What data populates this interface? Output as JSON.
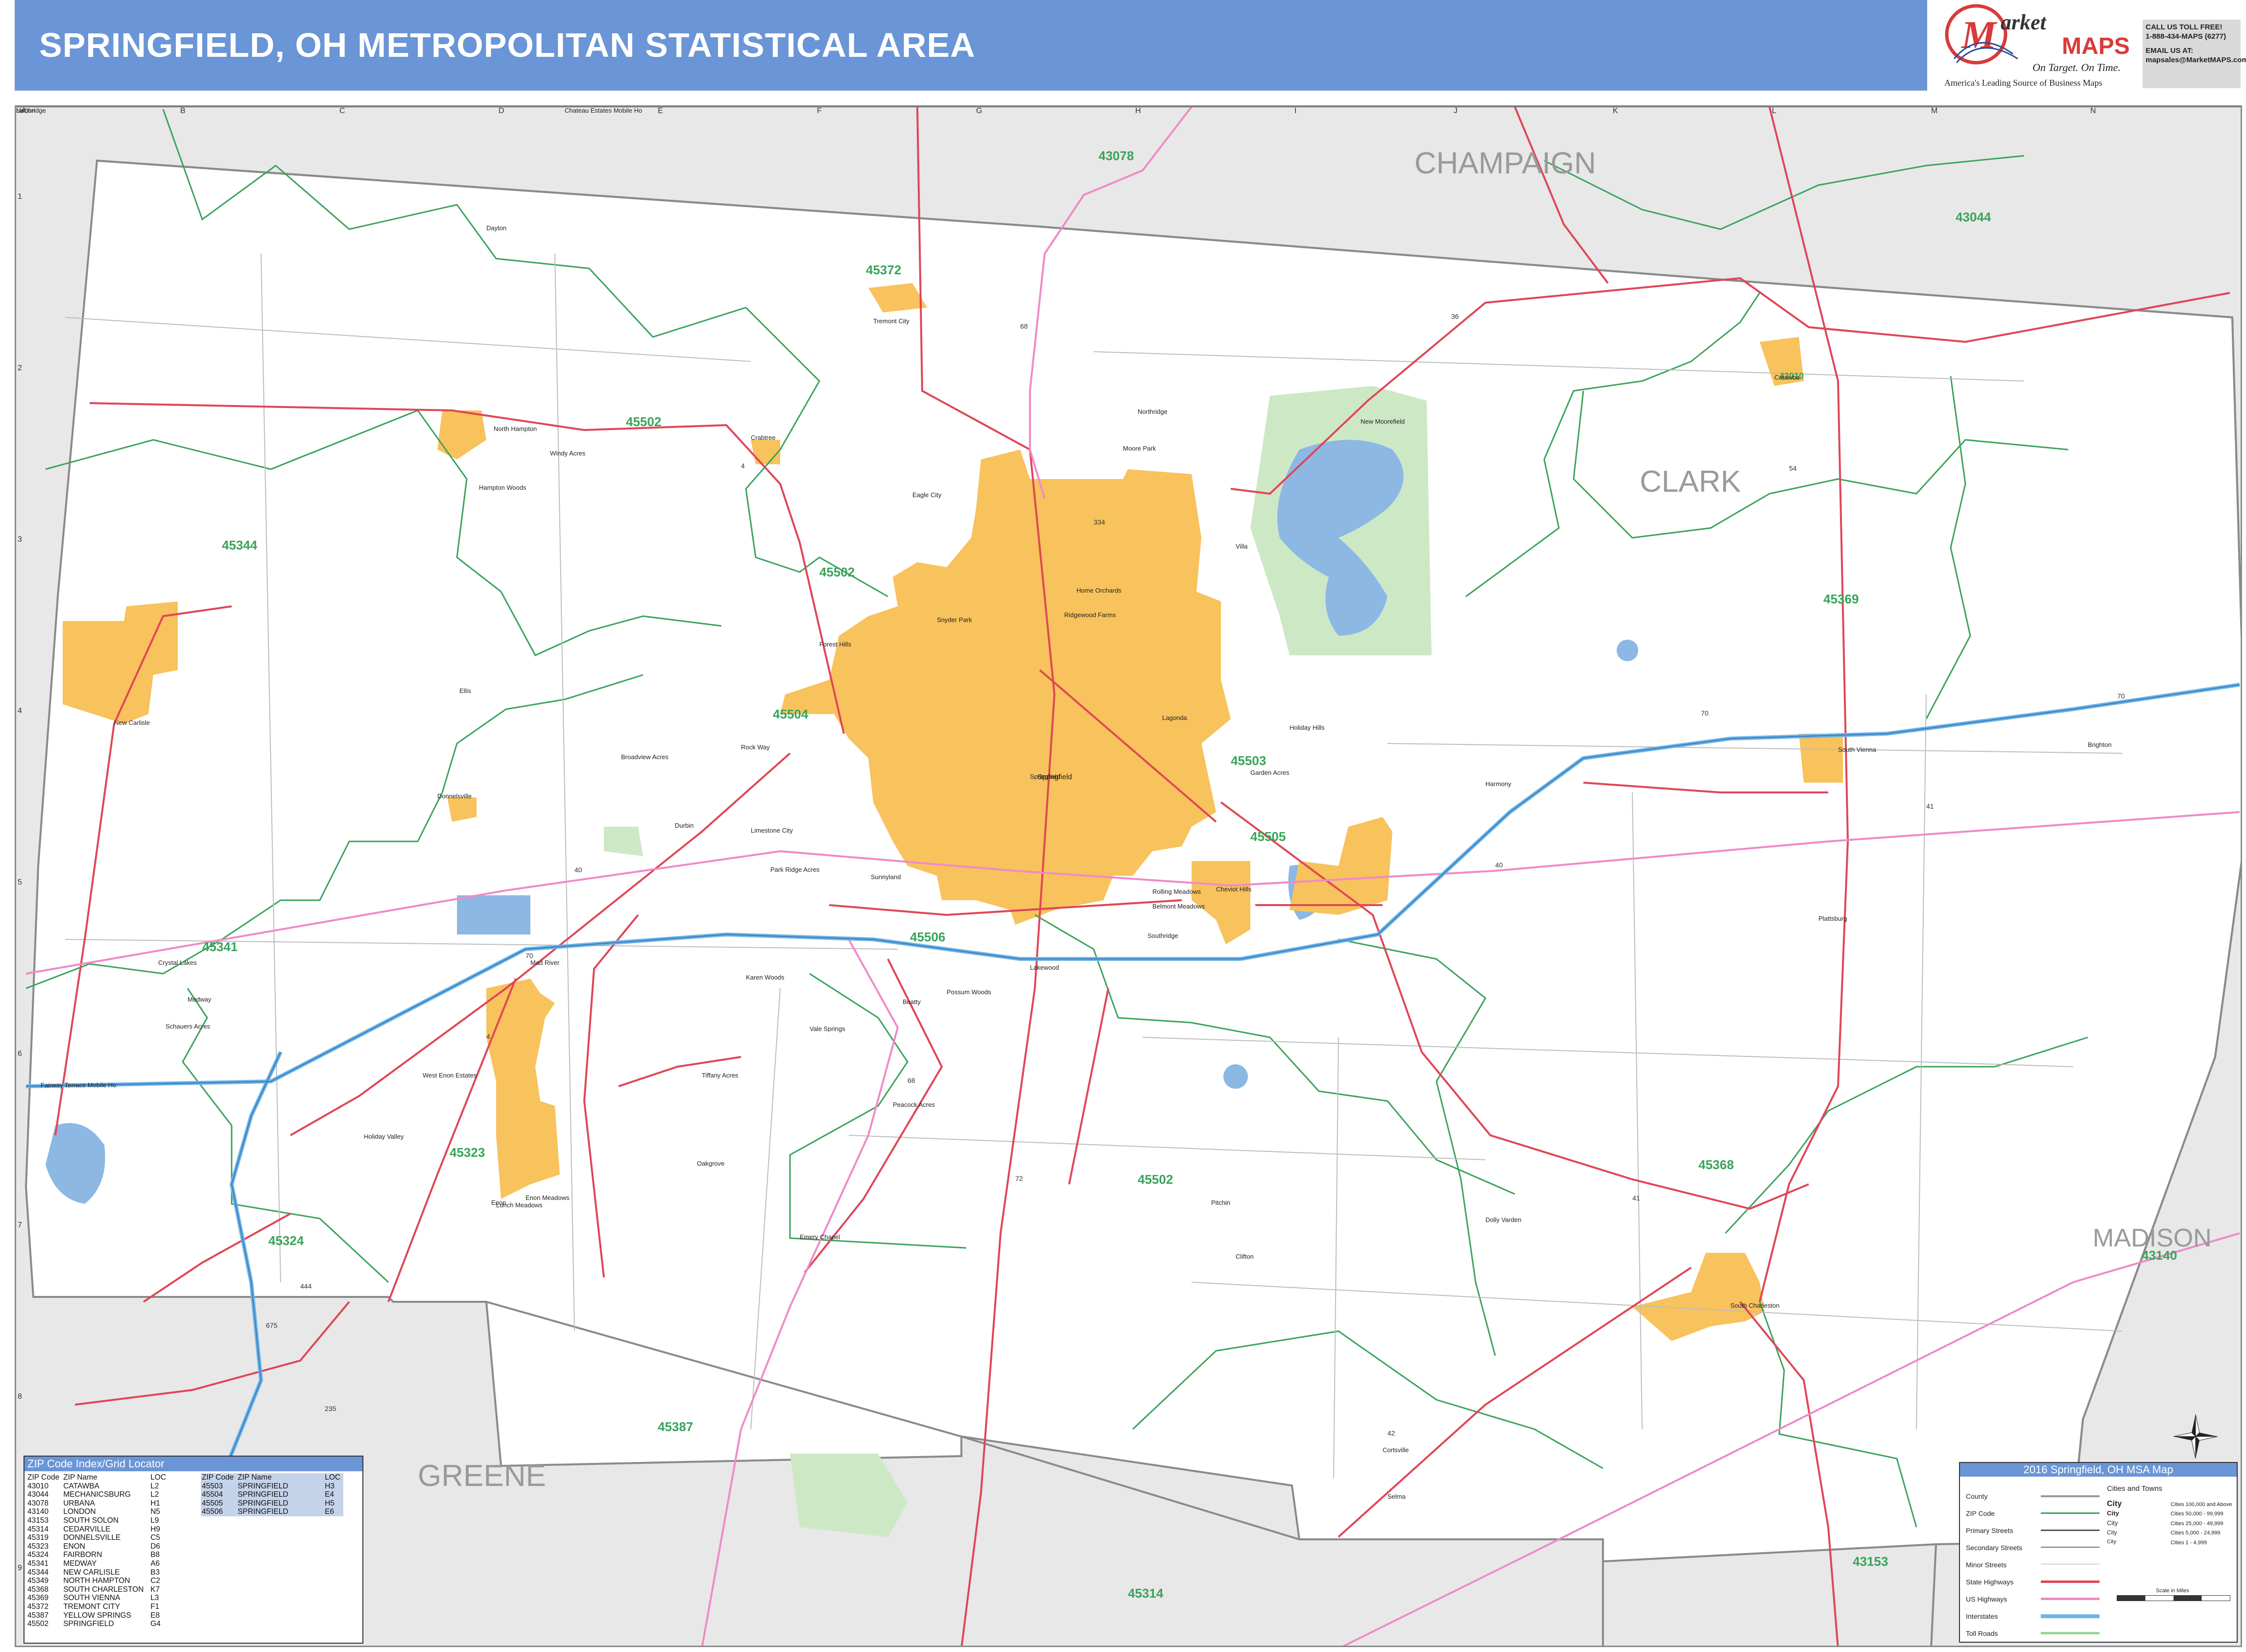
{
  "title": "SPRINGFIELD, OH METROPOLITAN STATISTICAL AREA",
  "logo": {
    "brand_top": "Market",
    "brand_bottom": "MAPS",
    "tagline": "On Target. On Time.",
    "slogan": "America's Leading Source of Business Maps"
  },
  "contact": {
    "line1": "CALL US TOLL FREE!",
    "line2": "1-888-434-MAPS (6277)",
    "line3": "EMAIL US AT:",
    "line4": "mapsales@MarketMAPS.com"
  },
  "grid": {
    "columns": [
      "A",
      "B",
      "C",
      "D",
      "E",
      "F",
      "G",
      "H",
      "I",
      "J",
      "K",
      "L",
      "M",
      "N"
    ],
    "rows": [
      "1",
      "2",
      "3",
      "4",
      "5",
      "6",
      "7",
      "8",
      "9"
    ]
  },
  "counties": [
    "CHAMPAIGN",
    "CLARK",
    "MADISON",
    "GREENE"
  ],
  "zip_labels": [
    "43078",
    "43044",
    "45372",
    "45502",
    "45344",
    "45502",
    "45369",
    "45504",
    "45503",
    "45505",
    "45506",
    "45341",
    "45323",
    "45324",
    "45502",
    "45368",
    "43140",
    "45387",
    "45314",
    "43153",
    "43010"
  ],
  "highway_labels": [
    "70",
    "70",
    "70",
    "40",
    "40",
    "68",
    "68",
    "4",
    "4",
    "41",
    "41",
    "72",
    "54",
    "334",
    "444",
    "675",
    "235",
    "42",
    "56",
    "36"
  ],
  "places": [
    "Dayton",
    "North Hampton",
    "Windy Acres",
    "Hampton Woods",
    "Chateau Estates Mobile Ho",
    "Crabtree",
    "Tremont City",
    "Eagle City",
    "Catawba",
    "Northridge",
    "New Moorefield",
    "Moore Park",
    "Snyder Park",
    "Home Orchards",
    "Villa",
    "Ridgewood Farms",
    "Enon",
    "New Carlisle",
    "Ellis",
    "Forest Hills",
    "Rock Way",
    "Broadview Acres",
    "Donnelsville",
    "Springfield",
    "Lagonda",
    "Garden Acres",
    "Harmony",
    "South Vienna",
    "Brighton",
    "Holiday Hills",
    "Durbin",
    "Limestone City",
    "Park Ridge Acres",
    "Sunnyland",
    "Northridge",
    "Springfield",
    "Crystal Lakes",
    "Medway",
    "Schauers Acres",
    "Mad River",
    "Beatty",
    "Karen Woods",
    "Possum Woods",
    "Lakewood",
    "Rolling Meadows",
    "Belmont Meadows",
    "Cheviot Hills",
    "Southridge",
    "Vale Springs",
    "Tiffany Acres",
    "Peacock Acres",
    "Oakgrove",
    "Emery Chapel",
    "Pitchin",
    "Clifton",
    "Dolly Varden",
    "Lisbon",
    "South Charleston",
    "Selma",
    "Cortsville",
    "Fairway Terrace Mobile Ho",
    "West Enon Estates",
    "Holiday Valley",
    "Enon Meadows",
    "Lunch Meadows",
    "Plattsburg"
  ],
  "zip_index": {
    "title": "ZIP Code Index/Grid Locator",
    "header": {
      "zip": "ZIP Code",
      "name": "ZIP Name",
      "loc": "LOC"
    },
    "col1": [
      [
        "43010",
        "CATAWBA",
        "L2"
      ],
      [
        "43044",
        "MECHANICSBURG",
        "L2"
      ],
      [
        "43078",
        "URBANA",
        "H1"
      ],
      [
        "43140",
        "LONDON",
        "N5"
      ],
      [
        "43153",
        "SOUTH SOLON",
        "L9"
      ],
      [
        "45314",
        "CEDARVILLE",
        "H9"
      ],
      [
        "45319",
        "DONNELSVILLE",
        "C5"
      ],
      [
        "45323",
        "ENON",
        "D6"
      ],
      [
        "45324",
        "FAIRBORN",
        "B8"
      ],
      [
        "45341",
        "MEDWAY",
        "A6"
      ],
      [
        "45344",
        "NEW CARLISLE",
        "B3"
      ],
      [
        "45349",
        "NORTH HAMPTON",
        "C2"
      ],
      [
        "45368",
        "SOUTH CHARLESTON",
        "K7"
      ],
      [
        "45369",
        "SOUTH VIENNA",
        "L3"
      ],
      [
        "45372",
        "TREMONT CITY",
        "F1"
      ],
      [
        "45387",
        "YELLOW SPRINGS",
        "E8"
      ],
      [
        "45502",
        "SPRINGFIELD",
        "G4"
      ]
    ],
    "col2": [
      [
        "45503",
        "SPRINGFIELD",
        "H3"
      ],
      [
        "45504",
        "SPRINGFIELD",
        "E4"
      ],
      [
        "45505",
        "SPRINGFIELD",
        "H5"
      ],
      [
        "45506",
        "SPRINGFIELD",
        "E6"
      ]
    ]
  },
  "legend": {
    "title": "2016 Springfield, OH MSA Map",
    "cities_header": "Cities and Towns",
    "items": [
      "County",
      "ZIP Code",
      "Primary Streets",
      "Secondary Streets",
      "Minor Streets",
      "State Highways",
      "US Highways",
      "Interstates",
      "Toll Roads"
    ],
    "cities": [
      {
        "label": "City",
        "pop": "Cities 100,000 and Above"
      },
      {
        "label": "City",
        "pop": "Cities 50,000 - 99,999"
      },
      {
        "label": "City",
        "pop": "Cities 25,000 - 49,999"
      },
      {
        "label": "City",
        "pop": "Cities 5,000 - 24,999"
      },
      {
        "label": "City",
        "pop": "Cities 1 - 4,999"
      }
    ],
    "scale_label": "Scale in Miles",
    "colors": {
      "county": "#9a9a9a",
      "zip": "#3aa35b",
      "state_hwy": "#e04656",
      "us_hwy": "#f08ac8",
      "interstate": "#6fb5e3",
      "city_fill": "#f8c25c",
      "water": "#8cb8e3",
      "park": "#cde8c5"
    }
  },
  "compass": {
    "n": "N",
    "s": "S",
    "e": "E",
    "w": "W"
  }
}
